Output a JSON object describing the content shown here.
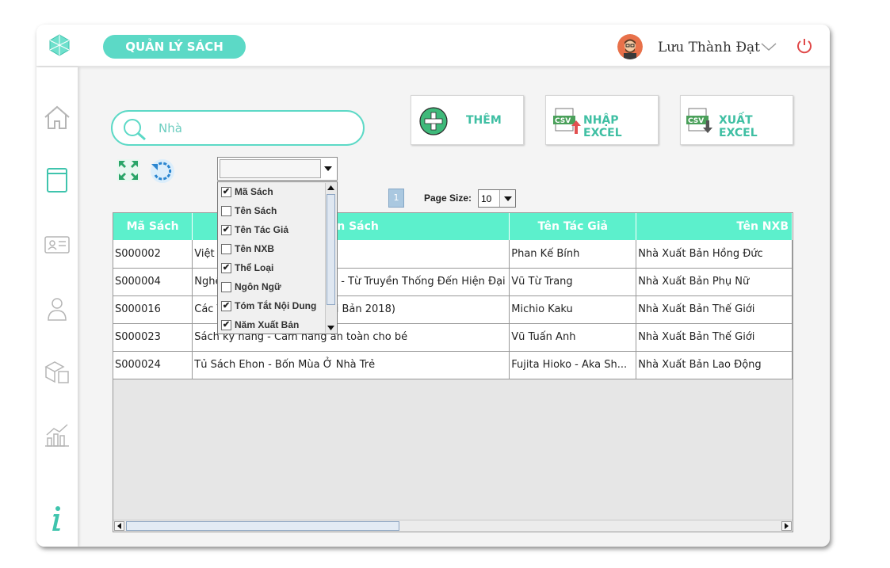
{
  "app": {
    "title": "QUẢN LÝ SÁCH"
  },
  "user": {
    "name": "Lưu Thành Đạt"
  },
  "sidebar": {
    "items": [
      "home-icon",
      "book-icon",
      "id-card-icon",
      "user-icon",
      "boxes-icon",
      "chart-icon",
      "info-icon"
    ]
  },
  "search": {
    "value": "Nhà"
  },
  "actions": {
    "add_label": "THÊM",
    "import_label": "NHẬP EXCEL",
    "export_label": "XUẤT EXCEL",
    "csv_text": "CSV"
  },
  "column_filter": {
    "selected": "",
    "options": [
      {
        "label": "Mã Sách",
        "checked": true
      },
      {
        "label": "Tên Sách",
        "checked": false
      },
      {
        "label": "Tên Tác Giả",
        "checked": true
      },
      {
        "label": "Tên NXB",
        "checked": false
      },
      {
        "label": "Thể Loại",
        "checked": true
      },
      {
        "label": "Ngôn Ngữ",
        "checked": false
      },
      {
        "label": "Tóm Tắt Nội Dung",
        "checked": true
      },
      {
        "label": "Năm Xuất Bản",
        "checked": true
      }
    ]
  },
  "pagination": {
    "current_page": "1",
    "page_size_label": "Page Size:",
    "page_size": "10"
  },
  "table": {
    "headers": [
      "Mã Sách",
      "Tên Sách",
      "Tên Tác Giả",
      "Tên NXB"
    ],
    "rows": [
      [
        "S000002",
        "Việt Nam Phong Tục",
        "Phan Kế Bính",
        "Nhà Xuất Bản Hồng Đức"
      ],
      [
        "S000004",
        "Nghệ Thuật Trang Phục Việt - Từ Truyền Thống Đến Hiện Đại",
        "Vũ Từ Trang",
        "Nhà Xuất Bản Phụ Nữ"
      ],
      [
        "S000016",
        "Các Thế Giới Song Song (Tái Bản 2018)",
        "Michio Kaku",
        "Nhà Xuất Bản Thế Giới"
      ],
      [
        "S000023",
        "Sách kỹ năng - Cẩm nang an toàn cho bé",
        "Vũ Tuấn Anh",
        "Nhà Xuất Bản Thế Giới"
      ],
      [
        "S000024",
        "Tủ Sách Ehon - Bốn Mùa Ở Nhà Trẻ",
        "Fujita Hioko - Aka Sh...",
        "Nhà Xuất Bản Lao Động"
      ]
    ]
  },
  "colors": {
    "accent": "#5cd9c6",
    "header": "#5cf0cc",
    "power": "#e04848"
  }
}
